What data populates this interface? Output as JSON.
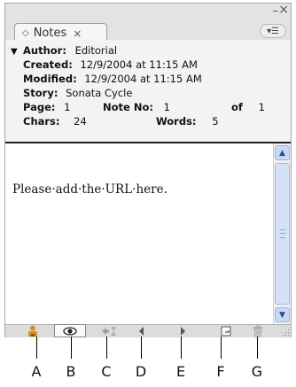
{
  "panel": {
    "tab_label": "Notes",
    "tab_close": "×",
    "window_minimize": "–",
    "window_close": "×",
    "menu_glyph": "▾☰"
  },
  "info": {
    "author_label": "Author:",
    "author_value": "Editorial",
    "created_label": "Created:",
    "created_value": "12/9/2004 at 11:15 AM",
    "modified_label": "Modified:",
    "modified_value": "12/9/2004 at 11:15 AM",
    "story_label": "Story:",
    "story_value": "Sonata Cycle",
    "page_label": "Page:",
    "page_value": "1",
    "noteno_label": "Note No:",
    "noteno_value": "1",
    "of_label": "of",
    "of_value": "1",
    "chars_label": "Chars:",
    "chars_value": "24",
    "words_label": "Words:",
    "words_value": "5"
  },
  "note": {
    "text": "Please·add·the·URL·here."
  },
  "toolbar": {
    "buttons": [
      {
        "icon": "user-icon",
        "color": "#d98c1f"
      },
      {
        "icon": "eye-icon",
        "color": "#222222"
      },
      {
        "icon": "go-to-text-icon",
        "color": "#9a9a9a"
      },
      {
        "icon": "previous-note-icon",
        "color": "#555555"
      },
      {
        "icon": "next-note-icon",
        "color": "#555555"
      },
      {
        "icon": "new-note-icon",
        "color": "#555555"
      },
      {
        "icon": "delete-note-icon",
        "color": "#9a9a9a"
      }
    ]
  },
  "callouts": [
    "A",
    "B",
    "C",
    "D",
    "E",
    "F",
    "G"
  ]
}
